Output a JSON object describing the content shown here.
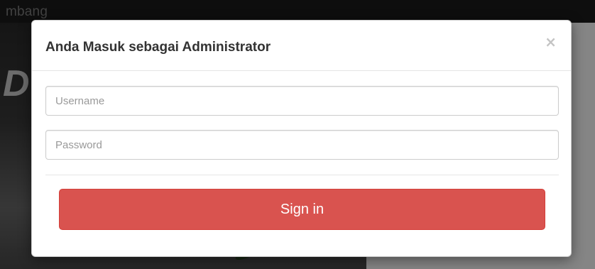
{
  "background": {
    "navbar_brand": "mbang"
  },
  "modal": {
    "title": "Anda Masuk sebagai Administrator",
    "close_symbol": "×",
    "close_icon": "close-icon",
    "username": {
      "value": "",
      "placeholder": "Username"
    },
    "password": {
      "value": "",
      "placeholder": "Password"
    },
    "signin_label": "Sign in"
  },
  "colors": {
    "signin_button": "#d9534f",
    "overlay": "rgba(0,0,0,0.48)",
    "navbar": "#1b1b1b"
  }
}
